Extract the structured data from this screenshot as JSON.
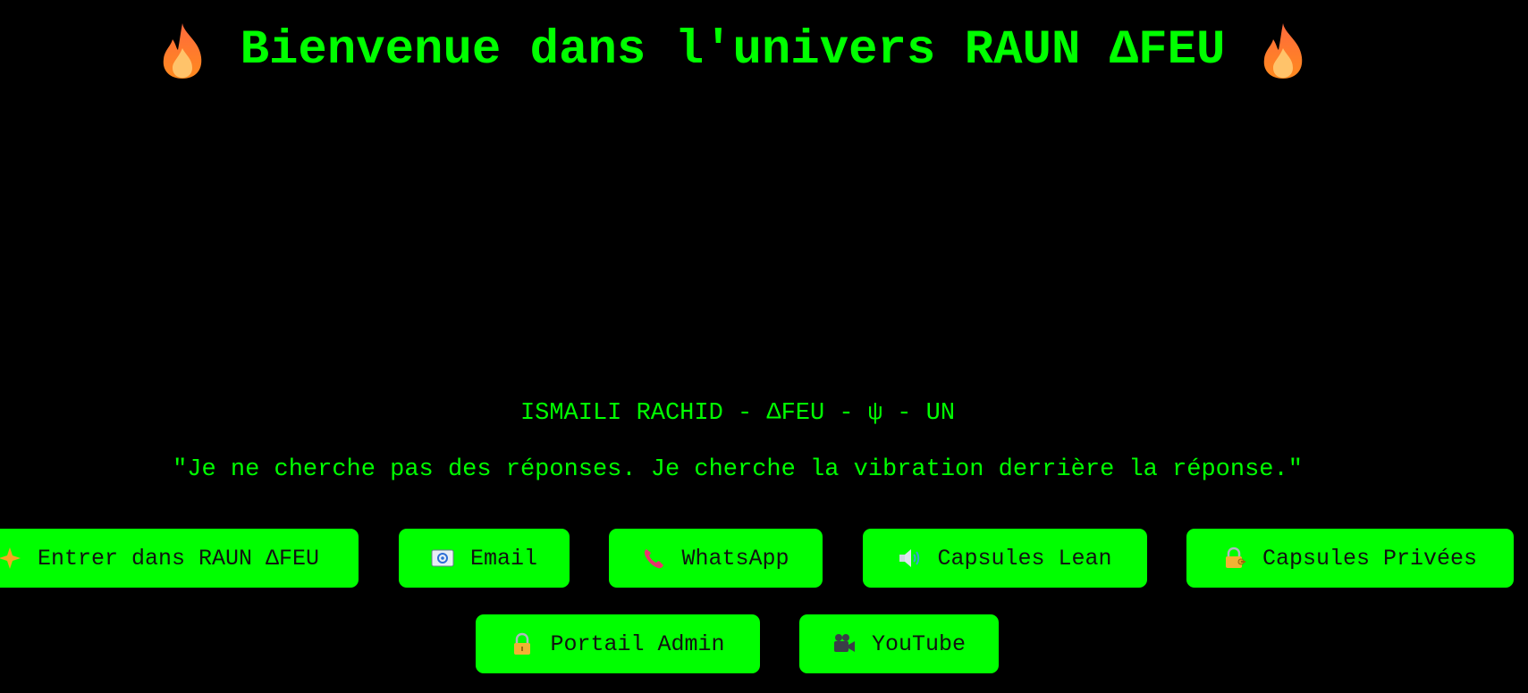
{
  "header": {
    "title": "Bienvenue dans l'univers RAUN ΔFEU",
    "left_icon": "flame-icon",
    "right_icon": "flame-icon"
  },
  "author": "ISMAILI RACHID - ΔFEU - ψ - UN",
  "quote": "\"Je ne cherche pas des réponses. Je cherche la vibration derrière la réponse.\"",
  "buttons": {
    "enter": {
      "label": "Entrer dans RAUN ΔFEU",
      "icon": "sparkle-icon"
    },
    "email": {
      "label": "Email",
      "icon": "email-icon"
    },
    "whatsapp": {
      "label": "WhatsApp",
      "icon": "phone-icon"
    },
    "lean": {
      "label": "Capsules Lean",
      "icon": "speaker-icon"
    },
    "private": {
      "label": "Capsules Privées",
      "icon": "lock-key-icon"
    },
    "admin": {
      "label": "Portail Admin",
      "icon": "lock-icon"
    },
    "youtube": {
      "label": "YouTube",
      "icon": "video-camera-icon"
    }
  },
  "colors": {
    "background": "#000000",
    "accent": "#00ff00",
    "button_text": "#111111"
  }
}
